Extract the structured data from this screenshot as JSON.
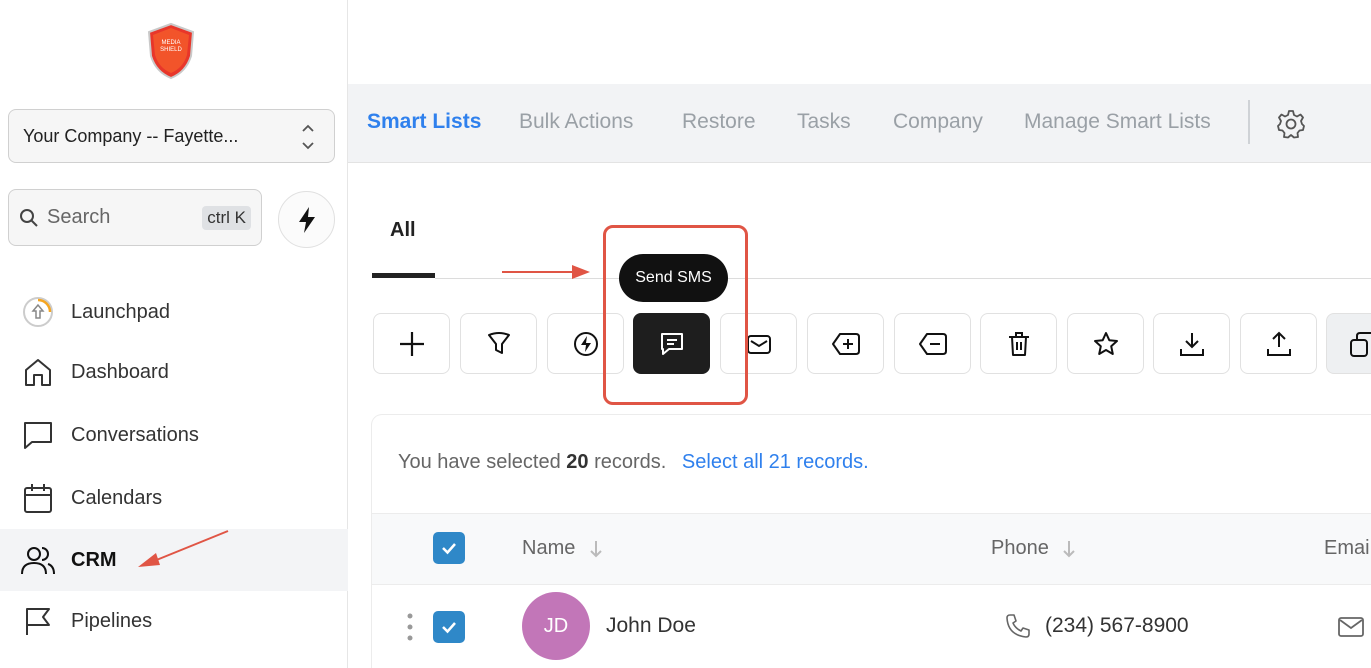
{
  "sidebar": {
    "logo_text": "MEDIA SHIELD",
    "company": "Your Company -- Fayette...",
    "search_placeholder": "Search",
    "search_shortcut": "ctrl K",
    "items": [
      {
        "label": "Launchpad",
        "icon": "launchpad-icon"
      },
      {
        "label": "Dashboard",
        "icon": "home-icon"
      },
      {
        "label": "Conversations",
        "icon": "chat-icon"
      },
      {
        "label": "Calendars",
        "icon": "calendar-icon"
      },
      {
        "label": "CRM",
        "icon": "users-icon",
        "active": true
      },
      {
        "label": "Pipelines",
        "icon": "flag-icon"
      }
    ]
  },
  "header": {
    "tabs": [
      {
        "label": "Smart Lists",
        "active": true
      },
      {
        "label": "Bulk Actions"
      },
      {
        "label": "Restore"
      },
      {
        "label": "Tasks"
      },
      {
        "label": "Company"
      },
      {
        "label": "Manage Smart Lists"
      }
    ]
  },
  "subtabs": {
    "all": "All"
  },
  "actions": [
    {
      "icon": "plus-icon",
      "name": "add"
    },
    {
      "icon": "filter-icon",
      "name": "filter"
    },
    {
      "icon": "workflow-icon",
      "name": "workflow"
    },
    {
      "icon": "sms-icon",
      "name": "send-sms",
      "active": true
    },
    {
      "icon": "email-icon",
      "name": "email"
    },
    {
      "icon": "add-tag-icon",
      "name": "add-tag"
    },
    {
      "icon": "remove-tag-icon",
      "name": "remove-tag"
    },
    {
      "icon": "trash-icon",
      "name": "delete"
    },
    {
      "icon": "star-icon",
      "name": "star"
    },
    {
      "icon": "download-icon",
      "name": "export"
    },
    {
      "icon": "upload-icon",
      "name": "import"
    },
    {
      "icon": "copy-icon",
      "name": "merge"
    }
  ],
  "tooltip": "Send SMS",
  "selection": {
    "prefix": "You have selected",
    "count": "20",
    "suffix": "records.",
    "link": "Select all 21 records."
  },
  "table": {
    "columns": [
      "Name",
      "Phone",
      "Emai"
    ],
    "rows": [
      {
        "initials": "JD",
        "name": "John Doe",
        "phone": "(234) 567-8900"
      }
    ]
  },
  "colors": {
    "accent": "#2f80ed",
    "highlight": "#e05545",
    "avatar": "#c276b8"
  }
}
